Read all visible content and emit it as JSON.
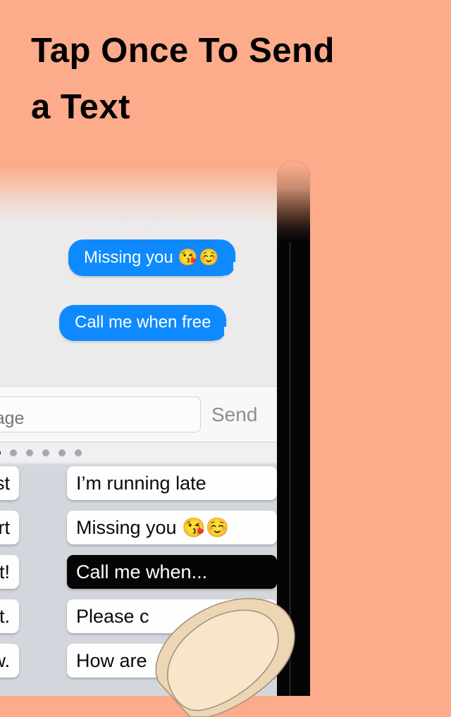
{
  "headline": {
    "line1": "Tap Once To Send",
    "line2": "a Text"
  },
  "colors": {
    "background": "#FCAB8B",
    "bubble_blue": "#0E8AFE",
    "chat_background": "#ECEBEB",
    "quickreply_background": "#D3D7DD",
    "selected_row": "#050505",
    "headline_text": "#000000"
  },
  "phone": {
    "chat": {
      "messages": [
        {
          "text": "Missing you",
          "emoji": "😘☺️",
          "side": "outgoing"
        },
        {
          "text": "Call me when free",
          "emoji": "",
          "side": "outgoing"
        }
      ]
    },
    "toolbar": {
      "message_placeholder": "Message",
      "send_label": "Send"
    },
    "pager": {
      "total": 7,
      "active_index": 1
    },
    "quick_replies": {
      "rows": [
        {
          "left": "illest",
          "right": "I’m running late",
          "selected": false
        },
        {
          "left": "art",
          "right": "Missing you 😘☺️",
          "selected": false
        },
        {
          "left": "ost!",
          "right": "Call me when...",
          "selected": true
        },
        {
          "left": "ght.",
          "right": "Please c",
          "selected": false
        },
        {
          "left": "ow.",
          "right": "How are",
          "selected": false
        }
      ]
    }
  }
}
